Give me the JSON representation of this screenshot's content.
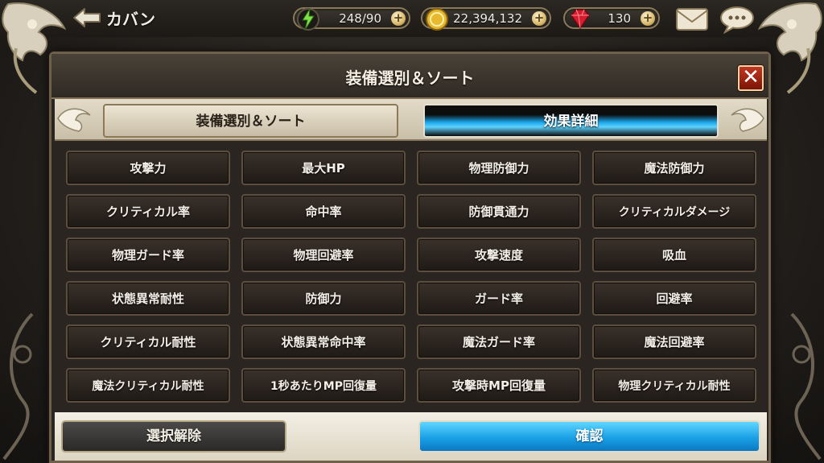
{
  "header": {
    "back_label": "カバン",
    "stamina": "248/90",
    "gold": "22,394,132",
    "gems": "130"
  },
  "dialog": {
    "title": "装備選別＆ソート",
    "tabs": [
      {
        "label": "装備選別＆ソート",
        "active": false
      },
      {
        "label": "効果詳細",
        "active": true
      }
    ],
    "options": [
      "攻撃力",
      "最大HP",
      "物理防御力",
      "魔法防御力",
      "クリティカル率",
      "命中率",
      "防御貫通力",
      "クリティカルダメージ",
      "物理ガード率",
      "物理回避率",
      "攻撃速度",
      "吸血",
      "状態異常耐性",
      "防御力",
      "ガード率",
      "回避率",
      "クリティカル耐性",
      "状態異常命中率",
      "魔法ガード率",
      "魔法回避率",
      "魔法クリティカル耐性",
      "1秒あたりMP回復量",
      "攻撃時MP回復量",
      "物理クリティカル耐性"
    ],
    "clear_label": "選択解除",
    "confirm_label": "確認"
  },
  "colors": {
    "accent_blue": "#1aa6ea",
    "close_red": "#c2361f",
    "gold_trim": "#8b7a5a"
  }
}
